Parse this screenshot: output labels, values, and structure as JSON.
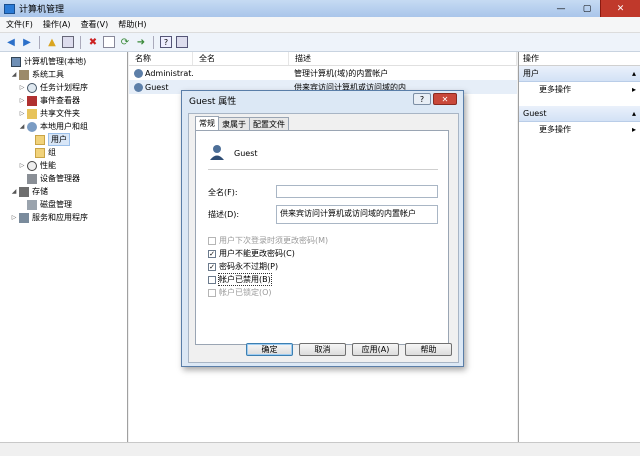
{
  "window": {
    "title": "计算机管理",
    "minimize": "—",
    "maximize": "▢",
    "close": "✕"
  },
  "menu": [
    "文件(F)",
    "操作(A)",
    "查看(V)",
    "帮助(H)"
  ],
  "tree": [
    {
      "label": "计算机管理(本地)",
      "level": 0,
      "exp": ""
    },
    {
      "label": "系统工具",
      "level": 1,
      "exp": "◢"
    },
    {
      "label": "任务计划程序",
      "level": 2,
      "exp": "▷"
    },
    {
      "label": "事件查看器",
      "level": 2,
      "exp": "▷"
    },
    {
      "label": "共享文件夹",
      "level": 2,
      "exp": "▷"
    },
    {
      "label": "本地用户和组",
      "level": 2,
      "exp": "◢"
    },
    {
      "label": "用户",
      "level": 3,
      "exp": ""
    },
    {
      "label": "组",
      "level": 3,
      "exp": ""
    },
    {
      "label": "性能",
      "level": 2,
      "exp": "▷"
    },
    {
      "label": "设备管理器",
      "level": 2,
      "exp": ""
    },
    {
      "label": "存储",
      "level": 1,
      "exp": "◢"
    },
    {
      "label": "磁盘管理",
      "level": 2,
      "exp": ""
    },
    {
      "label": "服务和应用程序",
      "level": 1,
      "exp": "▷"
    }
  ],
  "list": {
    "headers": [
      "名称",
      "全名",
      "描述"
    ],
    "rows": [
      {
        "name": "Administrat...",
        "full": "",
        "desc": "管理计算机(域)的内置帐户"
      },
      {
        "name": "Guest",
        "full": "",
        "desc": "供来宾访问计算机或访问域的内"
      }
    ]
  },
  "actions": {
    "header": "操作",
    "sections": [
      {
        "title": "用户",
        "item": "更多操作"
      },
      {
        "title": "Guest",
        "item": "更多操作"
      }
    ]
  },
  "dialog": {
    "title": "Guest 属性",
    "help": "?",
    "close": "✕",
    "tabs": [
      "常规",
      "隶属于",
      "配置文件"
    ],
    "username": "Guest",
    "fullname_label": "全名(F):",
    "fullname_value": "",
    "desc_label": "描述(D):",
    "desc_value": "供来宾访问计算机或访问域的内置帐户",
    "checkboxes": [
      {
        "label": "用户下次登录时须更改密码(M)",
        "checked": false,
        "disabled": true
      },
      {
        "label": "用户不能更改密码(C)",
        "checked": true,
        "disabled": false
      },
      {
        "label": "密码永不过期(P)",
        "checked": true,
        "disabled": false
      },
      {
        "label": "帐户已禁用(B)",
        "checked": false,
        "disabled": false
      },
      {
        "label": "帐户已锁定(O)",
        "checked": false,
        "disabled": true
      }
    ],
    "buttons": [
      "确定",
      "取消",
      "应用(A)",
      "帮助"
    ]
  }
}
